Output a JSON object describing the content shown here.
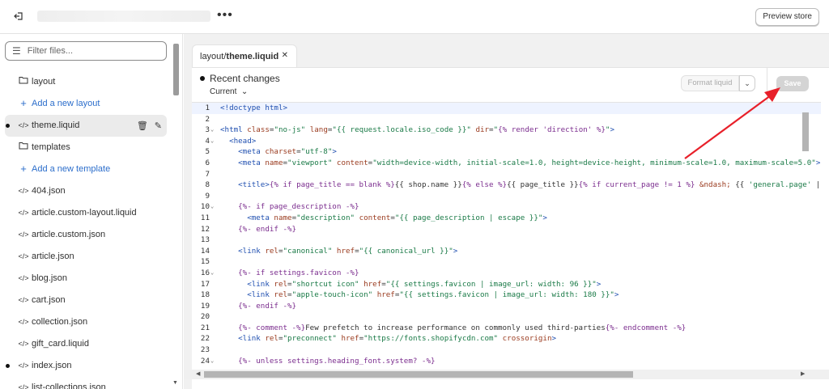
{
  "header": {
    "preview_label": "Preview store"
  },
  "sidebar": {
    "filter_placeholder": "Filter files...",
    "items": [
      {
        "label": "layout",
        "type": "folder"
      },
      {
        "label": "Add a new layout",
        "type": "add"
      },
      {
        "label": "theme.liquid",
        "type": "file",
        "modified": true,
        "selected": true
      },
      {
        "label": "templates",
        "type": "folder"
      },
      {
        "label": "Add a new template",
        "type": "add"
      },
      {
        "label": "404.json",
        "type": "file"
      },
      {
        "label": "article.custom-layout.liquid",
        "type": "file"
      },
      {
        "label": "article.custom.json",
        "type": "file"
      },
      {
        "label": "article.json",
        "type": "file"
      },
      {
        "label": "blog.json",
        "type": "file"
      },
      {
        "label": "cart.json",
        "type": "file"
      },
      {
        "label": "collection.json",
        "type": "file"
      },
      {
        "label": "gift_card.liquid",
        "type": "file"
      },
      {
        "label": "index.json",
        "type": "file",
        "modified": true
      },
      {
        "label": "list-collections.json",
        "type": "file"
      }
    ]
  },
  "tab": {
    "dir": "layout/",
    "file": "theme.liquid"
  },
  "toolbar": {
    "recent_changes": "Recent changes",
    "current": "Current",
    "format_label": "Format liquid",
    "save_label": "Save"
  },
  "code": {
    "lines": [
      {
        "n": "1",
        "html": "<span class='kw'>&lt;!doctype html&gt;</span>"
      },
      {
        "n": "2",
        "html": ""
      },
      {
        "n": "3",
        "fold": true,
        "html": "<span class='kw'>&lt;html</span> <span class='at'>class</span>=<span class='st'>\"no-js\"</span> <span class='at'>lang</span>=<span class='st'>\"{{ request.locale.iso_code }}\"</span> <span class='at'>dir</span>=<span class='st'>\"<span class='lq'>{% render 'direction' %}</span>\"</span><span class='kw'>&gt;</span>"
      },
      {
        "n": "4",
        "fold": true,
        "html": "  <span class='kw'>&lt;head&gt;</span>"
      },
      {
        "n": "5",
        "html": "    <span class='kw'>&lt;meta</span> <span class='at'>charset</span>=<span class='st'>\"utf-8\"</span><span class='kw'>&gt;</span>"
      },
      {
        "n": "6",
        "html": "    <span class='kw'>&lt;meta</span> <span class='at'>name</span>=<span class='st'>\"viewport\"</span> <span class='at'>content</span>=<span class='st'>\"width=device-width, initial-scale=1.0, height=device-height, minimum-scale=1.0, maximum-scale=5.0\"</span><span class='kw'>&gt;</span>"
      },
      {
        "n": "7",
        "html": ""
      },
      {
        "n": "8",
        "html": "    <span class='kw'>&lt;title&gt;</span><span class='lq'>{% if page_title == blank %}</span>{{ shop.name }}<span class='lq'>{% else %}</span>{{ page_title }}<span class='lq'>{% if current_page != 1 %}</span> <span class='at'>&amp;ndash;</span> {{ <span class='st'>'general.page'</span> | t"
      },
      {
        "n": "9",
        "html": ""
      },
      {
        "n": "10",
        "fold": true,
        "html": "    <span class='lq'>{%- if page_description -%}</span>"
      },
      {
        "n": "11",
        "html": "      <span class='kw'>&lt;meta</span> <span class='at'>name</span>=<span class='st'>\"description\"</span> <span class='at'>content</span>=<span class='st'>\"{{ page_description | escape }}\"</span><span class='kw'>&gt;</span>"
      },
      {
        "n": "12",
        "html": "    <span class='lq'>{%- endif -%}</span>"
      },
      {
        "n": "13",
        "html": ""
      },
      {
        "n": "14",
        "html": "    <span class='kw'>&lt;link</span> <span class='at'>rel</span>=<span class='st'>\"canonical\"</span> <span class='at'>href</span>=<span class='st'>\"{{ canonical_url }}\"</span><span class='kw'>&gt;</span>"
      },
      {
        "n": "15",
        "html": ""
      },
      {
        "n": "16",
        "fold": true,
        "html": "    <span class='lq'>{%- if settings.favicon -%}</span>"
      },
      {
        "n": "17",
        "html": "      <span class='kw'>&lt;link</span> <span class='at'>rel</span>=<span class='st'>\"shortcut icon\"</span> <span class='at'>href</span>=<span class='st'>\"{{ settings.favicon | image_url: width: 96 }}\"</span><span class='kw'>&gt;</span>"
      },
      {
        "n": "18",
        "html": "      <span class='kw'>&lt;link</span> <span class='at'>rel</span>=<span class='st'>\"apple-touch-icon\"</span> <span class='at'>href</span>=<span class='st'>\"{{ settings.favicon | image_url: width: 180 }}\"</span><span class='kw'>&gt;</span>"
      },
      {
        "n": "19",
        "html": "    <span class='lq'>{%- endif -%}</span>"
      },
      {
        "n": "20",
        "html": ""
      },
      {
        "n": "21",
        "html": "    <span class='lq'>{%- comment -%}</span>Few prefetch to increase performance on commonly used third-parties<span class='lq'>{%- endcomment -%}</span>"
      },
      {
        "n": "22",
        "html": "    <span class='kw'>&lt;link</span> <span class='at'>rel</span>=<span class='st'>\"preconnect\"</span> <span class='at'>href</span>=<span class='st'>\"https://fonts.shopifycdn.com\"</span> <span class='at'>crossorigin</span><span class='kw'>&gt;</span>"
      },
      {
        "n": "23",
        "html": ""
      },
      {
        "n": "24",
        "fold": true,
        "html": "    <span class='lq'>{%- unless settings.heading_font.system? -%}</span>"
      }
    ]
  },
  "colors": {
    "accent": "#2c6ecb",
    "annotation": "#e8202a"
  }
}
